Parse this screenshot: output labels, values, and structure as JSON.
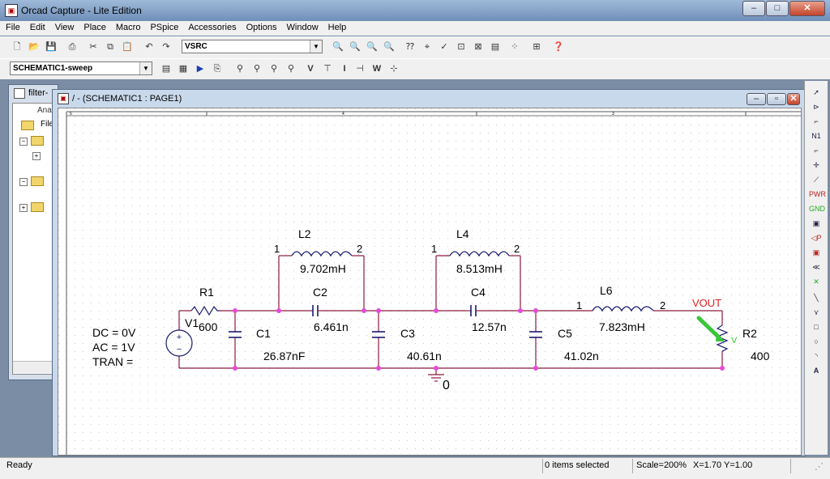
{
  "app": {
    "title": "Orcad Capture - Lite Edition"
  },
  "menu": [
    "File",
    "Edit",
    "View",
    "Place",
    "Macro",
    "PSpice",
    "Accessories",
    "Options",
    "Window",
    "Help"
  ],
  "toolbar1": {
    "part_combo": "VSRC"
  },
  "toolbar2": {
    "profile_combo": "SCHEMATIC1-sweep",
    "tool_letters": [
      "V",
      "I",
      "W"
    ]
  },
  "project_window": {
    "title": "filter-",
    "tab": "Ana",
    "item": "File"
  },
  "schematic_window": {
    "title": "/ - (SCHEMATIC1 : PAGE1)",
    "ruler": [
      "5",
      "4",
      "3"
    ]
  },
  "circuit": {
    "source_params": [
      "DC = 0V",
      "AC = 1V",
      "TRAN ="
    ],
    "parts": {
      "V1": "V1",
      "R1": "R1",
      "R1_val": "600",
      "C1": "C1",
      "C1_val": "26.87nF",
      "L2": "L2",
      "L2_val": "9.702mH",
      "C2": "C2",
      "C2_val": "6.461n",
      "C3": "C3",
      "C3_val": "40.61n",
      "L4": "L4",
      "L4_val": "8.513mH",
      "C4": "C4",
      "C4_val": "12.57n",
      "C5": "C5",
      "C5_val": "41.02n",
      "L6": "L6",
      "L6_val": "7.823mH",
      "R2": "R2",
      "R2_val": "400"
    },
    "pin_labels": {
      "one": "1",
      "two": "2"
    },
    "net_label": "VOUT",
    "ground": "0",
    "probe": "V"
  },
  "status": {
    "ready": "Ready",
    "selected": "0 items selected",
    "scale": "Scale=200%",
    "coords": "X=1.70  Y=1.00"
  },
  "colors": {
    "wire": "#8b1a3a",
    "junction": "#e64ad8",
    "netlabel": "#e02020",
    "probe": "#39c639",
    "part": "#1a1a6e"
  }
}
